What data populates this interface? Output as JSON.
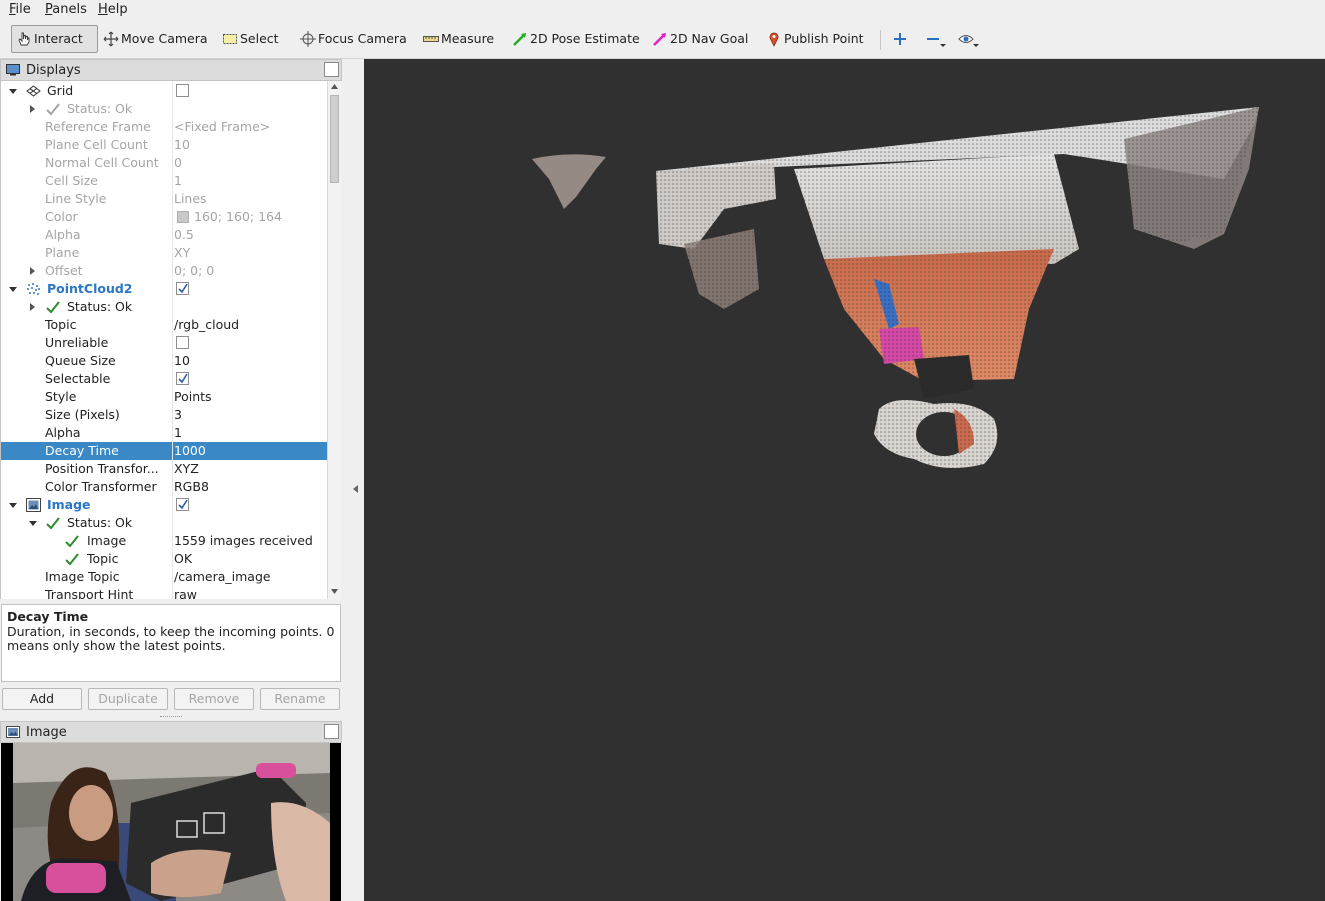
{
  "menubar": {
    "items": [
      "File",
      "Panels",
      "Help"
    ]
  },
  "toolbar": {
    "tools": [
      {
        "label": "Interact",
        "icon": "hand-pointer-icon"
      },
      {
        "label": "Move Camera",
        "icon": "move-camera-icon"
      },
      {
        "label": "Select",
        "icon": "select-rectangle-icon"
      },
      {
        "label": "Focus Camera",
        "icon": "crosshair-icon"
      },
      {
        "label": "Measure",
        "icon": "ruler-icon"
      },
      {
        "label": "2D Pose Estimate",
        "icon": "green-arrow-icon"
      },
      {
        "label": "2D Nav Goal",
        "icon": "magenta-arrow-icon"
      },
      {
        "label": "Publish Point",
        "icon": "map-pin-icon"
      }
    ]
  },
  "displays_panel": {
    "title": "Displays",
    "rows": {
      "grid": {
        "name": "Grid"
      },
      "grid_status": {
        "name": "Status: Ok"
      },
      "reference_frame": {
        "name": "Reference Frame",
        "value": "<Fixed Frame>"
      },
      "plane_cell_count": {
        "name": "Plane Cell Count",
        "value": "10"
      },
      "normal_cell_count": {
        "name": "Normal Cell Count",
        "value": "0"
      },
      "cell_size": {
        "name": "Cell Size",
        "value": "1"
      },
      "line_style": {
        "name": "Line Style",
        "value": "Lines"
      },
      "color": {
        "name": "Color",
        "value": "160; 160; 164"
      },
      "alpha_grid": {
        "name": "Alpha",
        "value": "0.5"
      },
      "plane": {
        "name": "Plane",
        "value": "XY"
      },
      "offset": {
        "name": "Offset",
        "value": "0; 0; 0"
      },
      "pointcloud2": {
        "name": "PointCloud2"
      },
      "pc_status": {
        "name": "Status: Ok"
      },
      "topic": {
        "name": "Topic",
        "value": "/rgb_cloud"
      },
      "unreliable": {
        "name": "Unreliable"
      },
      "queue_size": {
        "name": "Queue Size",
        "value": "10"
      },
      "selectable": {
        "name": "Selectable"
      },
      "style": {
        "name": "Style",
        "value": "Points"
      },
      "size_pixels": {
        "name": "Size (Pixels)",
        "value": "3"
      },
      "alpha_pc": {
        "name": "Alpha",
        "value": "1"
      },
      "decay_time": {
        "name": "Decay Time",
        "value": "1000"
      },
      "position_transformer": {
        "name": "Position Transfor...",
        "value": "XYZ"
      },
      "color_transformer": {
        "name": "Color Transformer",
        "value": "RGB8"
      },
      "image": {
        "name": "Image"
      },
      "img_status": {
        "name": "Status: Ok"
      },
      "img_image": {
        "name": "Image",
        "value": "1559 images received"
      },
      "img_topic": {
        "name": "Topic",
        "value": "OK"
      },
      "image_topic": {
        "name": "Image Topic",
        "value": "/camera_image"
      },
      "transport_hint": {
        "name": "Transport Hint",
        "value": "raw"
      }
    }
  },
  "help": {
    "title": "Decay Time",
    "text": "Duration, in seconds, to keep the incoming points. 0 means only show the latest points."
  },
  "buttons": {
    "add": "Add",
    "duplicate": "Duplicate",
    "remove": "Remove",
    "rename": "Rename"
  },
  "image_panel": {
    "title": "Image"
  },
  "colors": {
    "selection": "#3a88c5",
    "viewport_bg": "#303030",
    "display_name_blue": "#2b76c5",
    "status_ok_green": "#2e8b2e"
  }
}
